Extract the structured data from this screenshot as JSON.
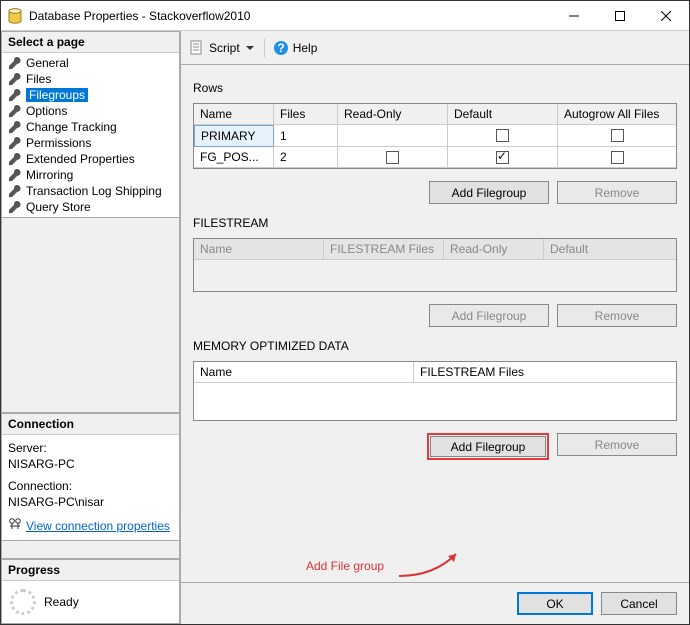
{
  "window": {
    "title": "Database Properties - Stackoverflow2010"
  },
  "nav": {
    "header": "Select a page",
    "items": [
      {
        "label": "General"
      },
      {
        "label": "Files"
      },
      {
        "label": "Filegroups"
      },
      {
        "label": "Options"
      },
      {
        "label": "Change Tracking"
      },
      {
        "label": "Permissions"
      },
      {
        "label": "Extended Properties"
      },
      {
        "label": "Mirroring"
      },
      {
        "label": "Transaction Log Shipping"
      },
      {
        "label": "Query Store"
      }
    ]
  },
  "connection": {
    "header": "Connection",
    "server_label": "Server:",
    "server_value": "NISARG-PC",
    "conn_label": "Connection:",
    "conn_value": "NISARG-PC\\nisar",
    "view_props": "View connection properties"
  },
  "progress": {
    "header": "Progress",
    "status": "Ready"
  },
  "toolbar": {
    "script": "Script",
    "help": "Help"
  },
  "sections": {
    "rows": "Rows",
    "filestream": "FILESTREAM",
    "memopt": "MEMORY OPTIMIZED DATA"
  },
  "headers": {
    "name": "Name",
    "files": "Files",
    "readonly": "Read-Only",
    "default": "Default",
    "autogrow": "Autogrow All Files",
    "fsfiles": "FILESTREAM Files"
  },
  "rows_data": [
    {
      "name": "PRIMARY",
      "files": "1",
      "readonly": false,
      "default": false,
      "autogrow": false,
      "readonly_hidden": true
    },
    {
      "name": "FG_POS...",
      "files": "2",
      "readonly": false,
      "default": true,
      "autogrow": false
    }
  ],
  "buttons": {
    "add_filegroup": "Add Filegroup",
    "remove": "Remove",
    "ok": "OK",
    "cancel": "Cancel"
  },
  "annotation": "Add File group"
}
